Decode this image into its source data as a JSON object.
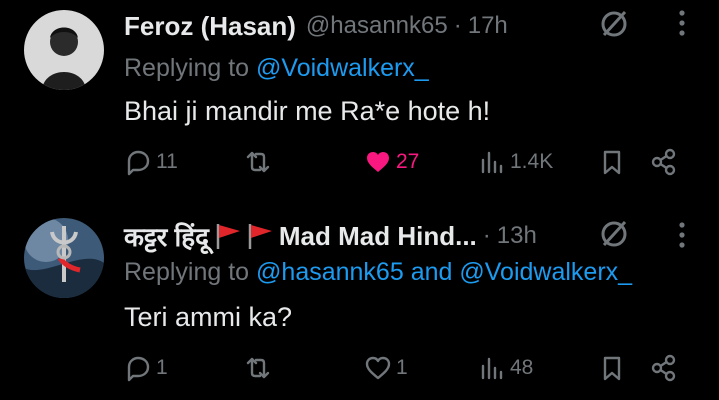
{
  "replies": [
    {
      "author_name": "Feroz (Hasan)",
      "handle": "@hasannk65",
      "dot": "·",
      "time": "17h",
      "replying_prefix": "Replying to",
      "mentions": [
        "@Voidwalkerx_"
      ],
      "mention_joiner": "",
      "text": "Bhai ji mandir me Ra*e hote h!",
      "stats": {
        "replies": "11",
        "reposts": "",
        "likes": "27",
        "views": "1.4K"
      },
      "liked": true
    },
    {
      "author_name": "कट्टर हिंदू",
      "author_suffix": "Mad Mad Hind...",
      "handle": "",
      "dot": "·",
      "time": "13h",
      "replying_prefix": "Replying to",
      "mentions": [
        "@hasannk65",
        "@Voidwalkerx_"
      ],
      "mention_joiner": "and",
      "text": "Teri ammi ka?",
      "stats": {
        "replies": "1",
        "reposts": "",
        "likes": "1",
        "views": "48"
      },
      "liked": false
    }
  ],
  "colors": {
    "background": "#000000",
    "text": "#e7e9ea",
    "muted": "#71767b",
    "link": "#1d9bf0",
    "like": "#f91880",
    "flag": "#e0262b"
  },
  "icons": [
    "reply-icon",
    "repost-icon",
    "like-icon",
    "views-icon",
    "bookmark-icon",
    "share-icon",
    "grok-icon",
    "more-icon"
  ]
}
